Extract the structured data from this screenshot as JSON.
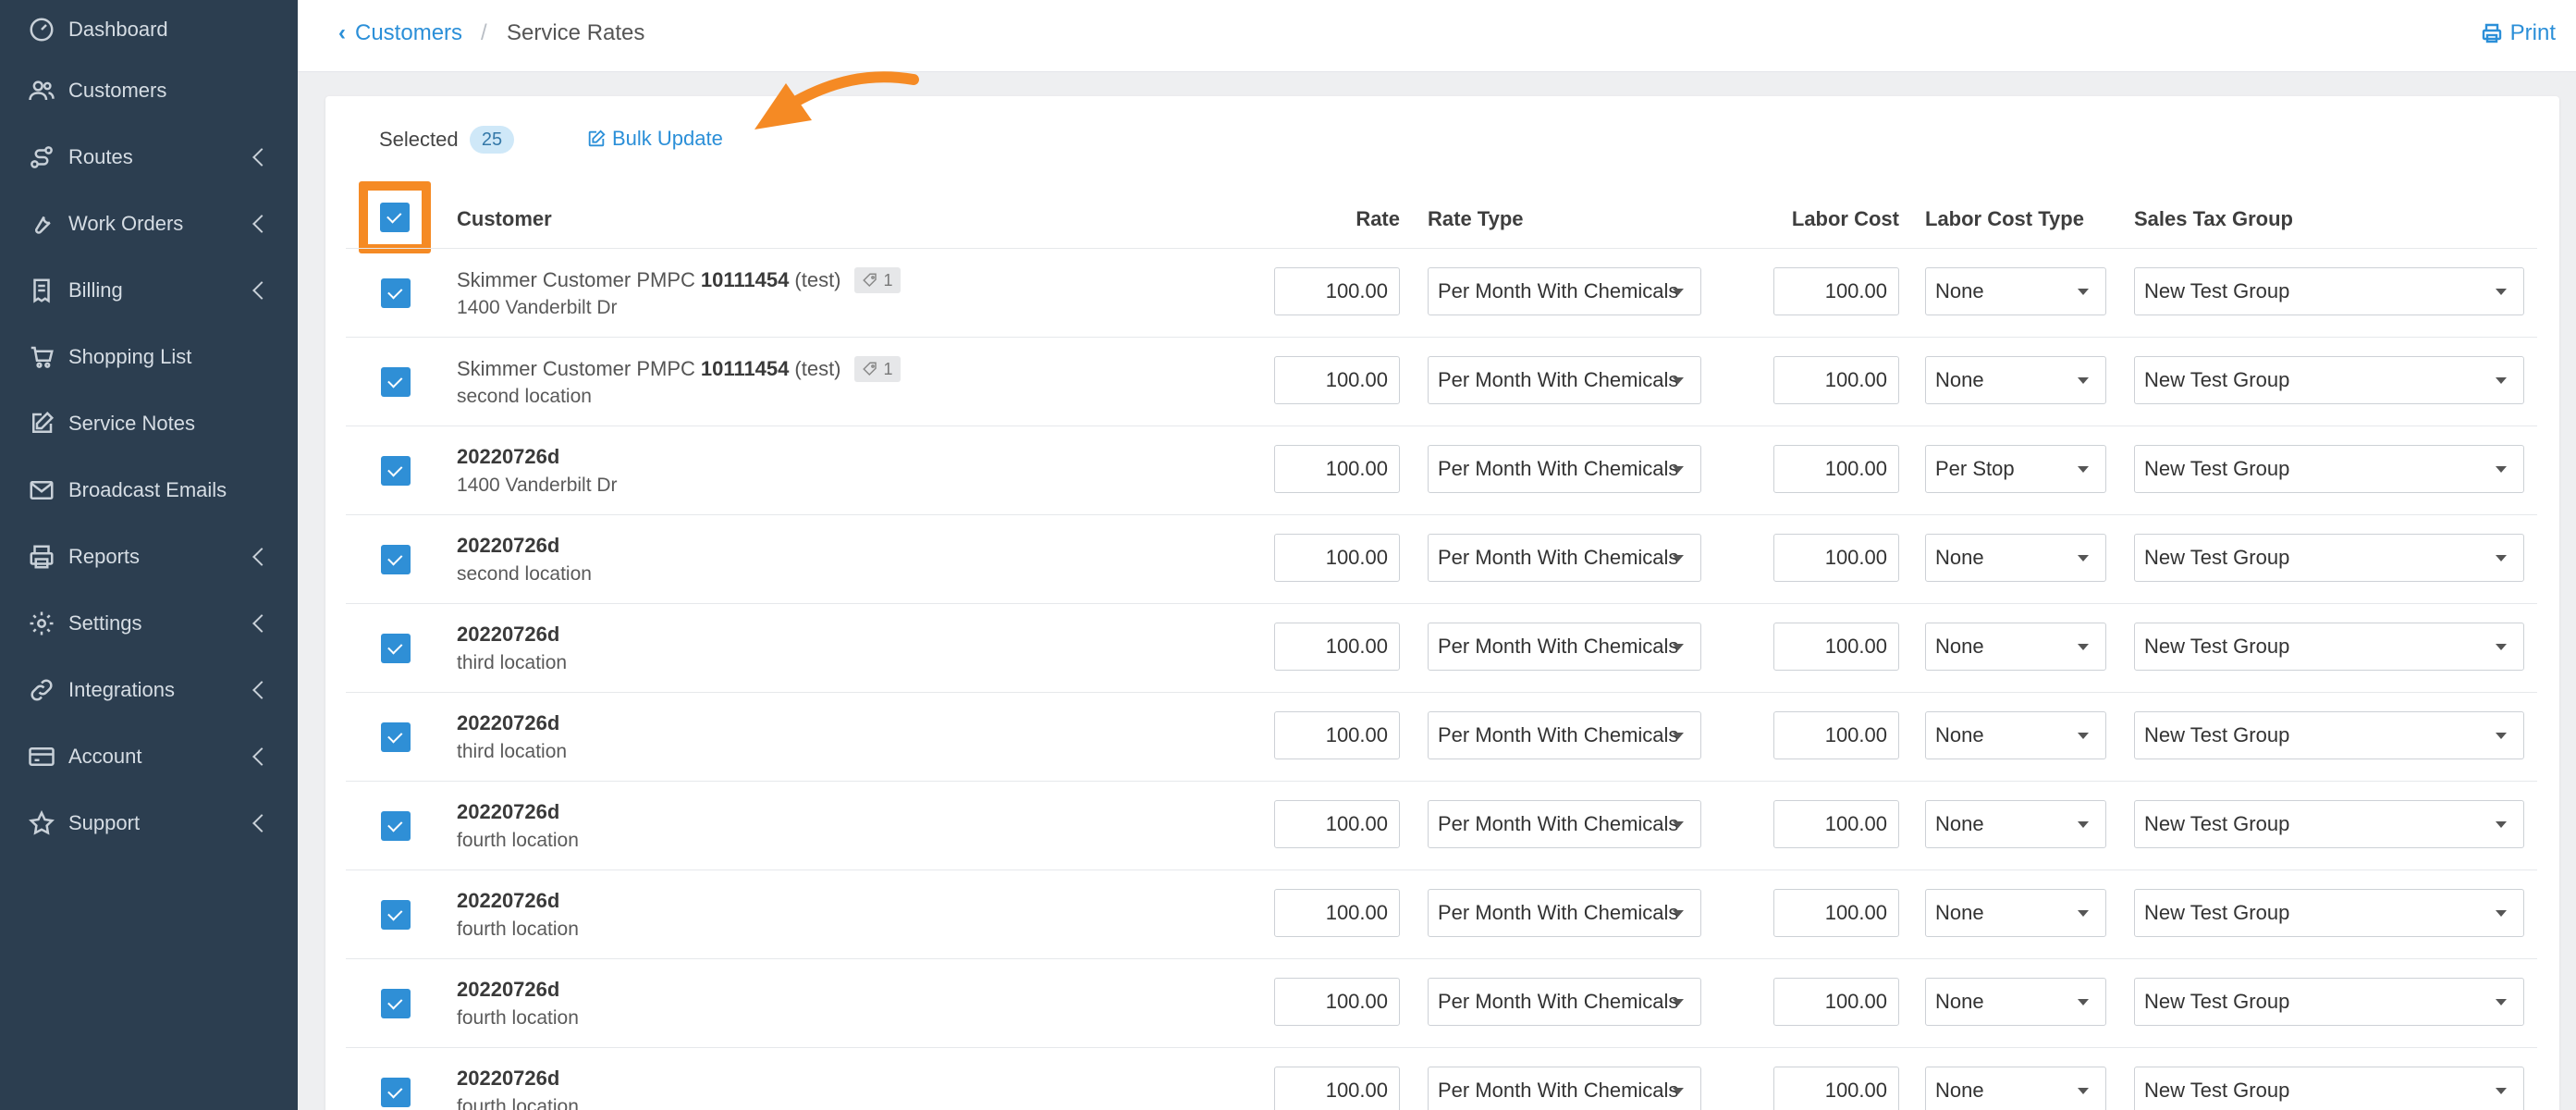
{
  "sidebar": {
    "items": [
      {
        "label": "Dashboard",
        "icon": "dashboard-icon",
        "chevron": false
      },
      {
        "label": "Customers",
        "icon": "users-icon",
        "chevron": false
      },
      {
        "label": "Routes",
        "icon": "route-icon",
        "chevron": true
      },
      {
        "label": "Work Orders",
        "icon": "wrench-icon",
        "chevron": true
      },
      {
        "label": "Billing",
        "icon": "invoice-icon",
        "chevron": true
      },
      {
        "label": "Shopping List",
        "icon": "cart-icon",
        "chevron": false
      },
      {
        "label": "Service Notes",
        "icon": "edit-icon",
        "chevron": false
      },
      {
        "label": "Broadcast Emails",
        "icon": "envelope-icon",
        "chevron": false
      },
      {
        "label": "Reports",
        "icon": "printer-icon",
        "chevron": true
      },
      {
        "label": "Settings",
        "icon": "gear-icon",
        "chevron": true
      },
      {
        "label": "Integrations",
        "icon": "link-icon",
        "chevron": true
      },
      {
        "label": "Account",
        "icon": "credit-card-icon",
        "chevron": true
      },
      {
        "label": "Support",
        "icon": "star-icon",
        "chevron": true
      }
    ]
  },
  "header": {
    "back_label": "Customers",
    "separator": "/",
    "current": "Service Rates",
    "print_label": "Print"
  },
  "toolbar": {
    "selected_label": "Selected",
    "selected_count": "25",
    "bulk_update_label": "Bulk Update"
  },
  "table": {
    "columns": {
      "customer": "Customer",
      "rate": "Rate",
      "rate_type": "Rate Type",
      "labor_cost": "Labor Cost",
      "labor_cost_type": "Labor Cost Type",
      "sales_tax_group": "Sales Tax Group"
    },
    "rows": [
      {
        "prefix": "Skimmer Customer PMPC",
        "bold": "10111454",
        "suffix": "(test)",
        "tag_count": "1",
        "location": "1400 Vanderbilt Dr",
        "rate": "100.00",
        "rate_type": "Per Month With Chemicals",
        "labor_cost": "100.00",
        "labor_cost_type": "None",
        "sales_tax_group": "New Test Group"
      },
      {
        "prefix": "Skimmer Customer PMPC",
        "bold": "10111454",
        "suffix": "(test)",
        "tag_count": "1",
        "location": "second location",
        "rate": "100.00",
        "rate_type": "Per Month With Chemicals",
        "labor_cost": "100.00",
        "labor_cost_type": "None",
        "sales_tax_group": "New Test Group"
      },
      {
        "prefix": "",
        "bold": "20220726d",
        "suffix": "",
        "tag_count": "",
        "location": "1400 Vanderbilt Dr",
        "rate": "100.00",
        "rate_type": "Per Month With Chemicals",
        "labor_cost": "100.00",
        "labor_cost_type": "Per Stop",
        "sales_tax_group": "New Test Group"
      },
      {
        "prefix": "",
        "bold": "20220726d",
        "suffix": "",
        "tag_count": "",
        "location": "second location",
        "rate": "100.00",
        "rate_type": "Per Month With Chemicals",
        "labor_cost": "100.00",
        "labor_cost_type": "None",
        "sales_tax_group": "New Test Group"
      },
      {
        "prefix": "",
        "bold": "20220726d",
        "suffix": "",
        "tag_count": "",
        "location": "third location",
        "rate": "100.00",
        "rate_type": "Per Month With Chemicals",
        "labor_cost": "100.00",
        "labor_cost_type": "None",
        "sales_tax_group": "New Test Group"
      },
      {
        "prefix": "",
        "bold": "20220726d",
        "suffix": "",
        "tag_count": "",
        "location": "third location",
        "rate": "100.00",
        "rate_type": "Per Month With Chemicals",
        "labor_cost": "100.00",
        "labor_cost_type": "None",
        "sales_tax_group": "New Test Group"
      },
      {
        "prefix": "",
        "bold": "20220726d",
        "suffix": "",
        "tag_count": "",
        "location": "fourth location",
        "rate": "100.00",
        "rate_type": "Per Month With Chemicals",
        "labor_cost": "100.00",
        "labor_cost_type": "None",
        "sales_tax_group": "New Test Group"
      },
      {
        "prefix": "",
        "bold": "20220726d",
        "suffix": "",
        "tag_count": "",
        "location": "fourth location",
        "rate": "100.00",
        "rate_type": "Per Month With Chemicals",
        "labor_cost": "100.00",
        "labor_cost_type": "None",
        "sales_tax_group": "New Test Group"
      },
      {
        "prefix": "",
        "bold": "20220726d",
        "suffix": "",
        "tag_count": "",
        "location": "fourth location",
        "rate": "100.00",
        "rate_type": "Per Month With Chemicals",
        "labor_cost": "100.00",
        "labor_cost_type": "None",
        "sales_tax_group": "New Test Group"
      },
      {
        "prefix": "",
        "bold": "20220726d",
        "suffix": "",
        "tag_count": "",
        "location": "fourth location",
        "rate": "100.00",
        "rate_type": "Per Month With Chemicals",
        "labor_cost": "100.00",
        "labor_cost_type": "None",
        "sales_tax_group": "New Test Group"
      }
    ]
  },
  "colors": {
    "sidebar_bg": "#2c3e50",
    "accent": "#2b8fd8",
    "annotation": "#f58a24"
  }
}
